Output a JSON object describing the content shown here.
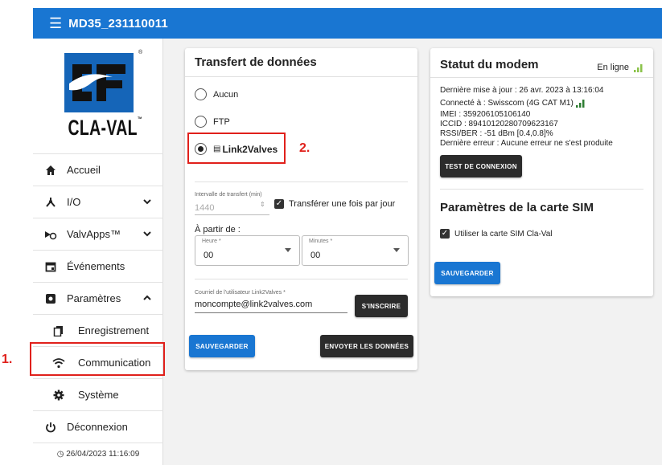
{
  "header": {
    "title": "MD35_231110011",
    "menu_icon": "menu-icon"
  },
  "logo": {
    "brand": "CLA-VAL",
    "tm": "™",
    "reg": "®"
  },
  "sidebar": {
    "items": [
      {
        "label": "Accueil",
        "icon": "home-icon"
      },
      {
        "label": "I/O",
        "icon": "io-icon"
      },
      {
        "label": "ValvApps™",
        "icon": "valvapps-icon"
      },
      {
        "label": "Événements",
        "icon": "calendar-icon"
      },
      {
        "label": "Paramètres",
        "icon": "settings-icon"
      },
      {
        "label": "Enregistrement",
        "icon": "copy-icon"
      },
      {
        "label": "Communication",
        "icon": "wifi-icon"
      },
      {
        "label": "Système",
        "icon": "gear-icon"
      },
      {
        "label": "Déconnexion",
        "icon": "power-icon"
      }
    ],
    "datetime": "26/04/2023 11:16:09"
  },
  "annotations": {
    "one": "1.",
    "two": "2."
  },
  "transfer": {
    "title": "Transfert de données",
    "options": [
      "Aucun",
      "FTP",
      "Link2Valves"
    ],
    "selected": "Link2Valves",
    "interval_label": "Intervalle de transfert (min)",
    "interval_value": "1440",
    "once_per_day_label": "Transférer une fois par jour",
    "once_per_day_checked": true,
    "from_label": "À partir de :",
    "hour_label": "Heure *",
    "hour_value": "00",
    "minutes_label": "Minutes *",
    "minutes_value": "00",
    "user_label": "Courriel de l'utilisateur Link2Valves *",
    "user_value": "moncompte@link2valves.com",
    "signup_button": "S'INSCRIRE",
    "save_button": "SAUVEGARDER",
    "send_button": "ENVOYER LES DONNÉES"
  },
  "modem": {
    "title": "Statut du modem",
    "status": "En ligne",
    "last_update": "Dernière mise à jour : 26 avr. 2023 à 13:16:04",
    "connected": "Connecté à : Swisscom (4G CAT M1)",
    "imei": "IMEI : 359206105106140",
    "iccid": "ICCID : 89410120280709623167",
    "rssi": "RSSI/BER : -51 dBm [0.4,0.8]%",
    "last_error": "Dernière erreur : Aucune erreur ne s'est produite",
    "test_button": "TEST DE CONNEXION",
    "sim_title": "Paramètres de la carte SIM",
    "sim_checkbox": "Utiliser la carte SIM Cla-Val",
    "sim_checked": true,
    "save_button": "SAUVEGARDER",
    "accent": "#4caf50"
  },
  "colors": {
    "primary": "#1976d2",
    "annotation": "#e0201b",
    "signal": "#4caf50"
  }
}
